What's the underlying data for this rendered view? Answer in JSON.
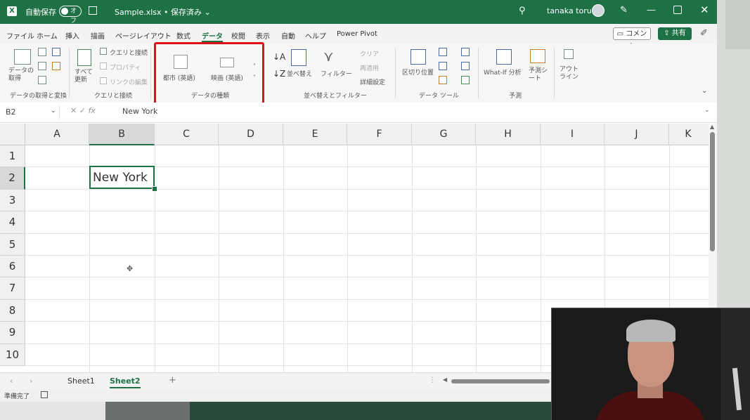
{
  "titlebar": {
    "autosave_label": "自動保存",
    "autosave_state": "オフ",
    "document": "Sample.xlsx • 保存済み ⌄",
    "user": "tanaka toru"
  },
  "menu": {
    "tabs": [
      "ファイル",
      "ホーム",
      "挿入",
      "描画",
      "ページレイアウト",
      "数式",
      "データ",
      "校閲",
      "表示",
      "自動",
      "ヘルプ",
      "Power Pivot"
    ],
    "active": "データ",
    "comment": "コメント",
    "share": "共有"
  },
  "ribbon": {
    "get_data": {
      "label": "データの取得",
      "group": "データの取得と変換"
    },
    "refresh": {
      "label": "すべて更新",
      "group": "クエリと接続",
      "items": [
        "クエリと接続",
        "プロパティ",
        "リンクの編集"
      ]
    },
    "data_types": {
      "city": "都市 (英語)",
      "movie": "映画 (英語)",
      "group": "データの種類"
    },
    "sort": {
      "sort_label": "並べ替え",
      "filter_label": "フィルター",
      "clear": "クリア",
      "reapply": "再適用",
      "advanced": "詳細設定",
      "group": "並べ替えとフィルター"
    },
    "tools": {
      "split": "区切り位置",
      "group": "データ ツール"
    },
    "forecast": {
      "whatif": "What-If 分析",
      "sheet": "予測シート",
      "group": "予測"
    },
    "outline": {
      "label": "アウトライン"
    }
  },
  "formula_bar": {
    "name_box": "B2",
    "value": "New York"
  },
  "grid": {
    "columns": [
      "A",
      "B",
      "C",
      "D",
      "E",
      "F",
      "G",
      "H",
      "I",
      "J",
      "K"
    ],
    "rows": [
      "1",
      "2",
      "3",
      "4",
      "5",
      "6",
      "7",
      "8",
      "9",
      "10"
    ],
    "selected_column": "B",
    "selected_row": "2",
    "cell_b2": "New York"
  },
  "sheets": [
    "Sheet1",
    "Sheet2"
  ],
  "active_sheet": "Sheet2",
  "status": "準備完了",
  "colors": {
    "excel_green": "#1e7145",
    "highlight_red": "#e0101a"
  }
}
